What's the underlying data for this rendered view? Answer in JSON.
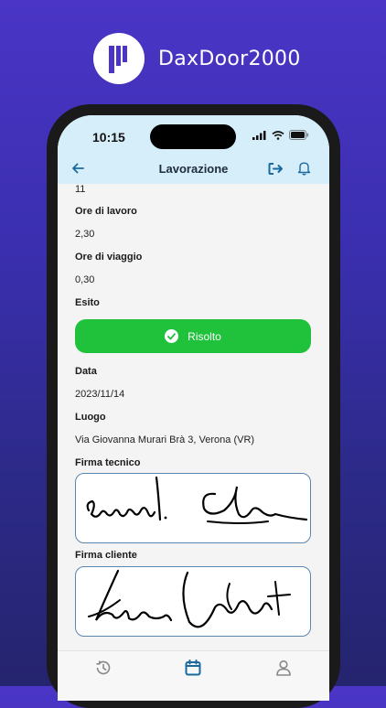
{
  "brand": {
    "name": "DaxDoor2000"
  },
  "status_bar": {
    "time": "10:15"
  },
  "nav": {
    "title": "Lavorazione"
  },
  "details": {
    "top_value": "11",
    "ore_lavoro_label": "Ore di lavoro",
    "ore_lavoro_value": "2,30",
    "ore_viaggio_label": "Ore di viaggio",
    "ore_viaggio_value": "0,30",
    "esito_label": "Esito",
    "esito_value": "Risolto",
    "data_label": "Data",
    "data_value": "2023/11/14",
    "luogo_label": "Luogo",
    "luogo_value": "Via Giovanna Murari Brà 3, Verona (VR)",
    "firma_tecnico_label": "Firma tecnico",
    "firma_cliente_label": "Firma cliente"
  },
  "colors": {
    "accent": "#1a6aa0",
    "success": "#1fc23a",
    "header": "#d6eefa",
    "background": "#3b2fb0"
  },
  "tabs": [
    {
      "icon": "history-icon"
    },
    {
      "icon": "calendar-icon",
      "active": true
    },
    {
      "icon": "profile-icon"
    }
  ]
}
